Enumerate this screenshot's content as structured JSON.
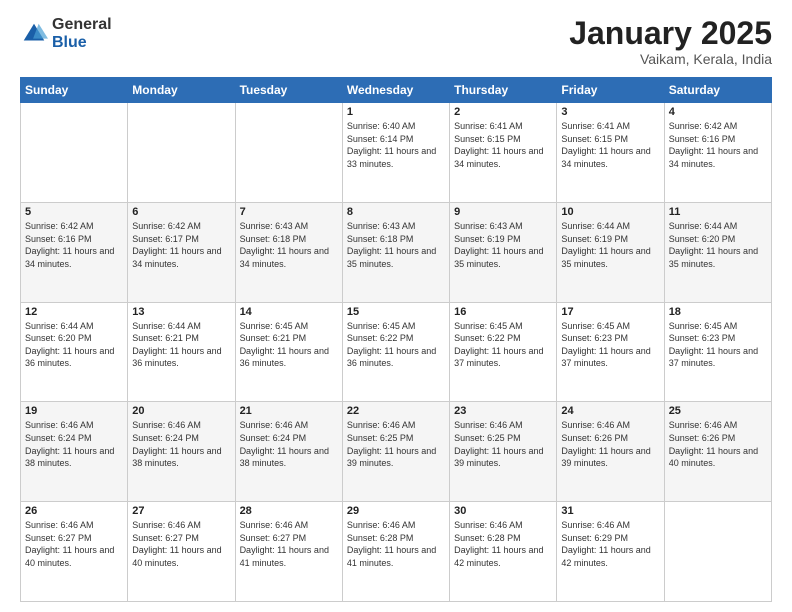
{
  "header": {
    "logo_general": "General",
    "logo_blue": "Blue",
    "title": "January 2025",
    "location": "Vaikam, Kerala, India"
  },
  "days_of_week": [
    "Sunday",
    "Monday",
    "Tuesday",
    "Wednesday",
    "Thursday",
    "Friday",
    "Saturday"
  ],
  "weeks": [
    [
      {
        "day": "",
        "sunrise": "",
        "sunset": "",
        "daylight": ""
      },
      {
        "day": "",
        "sunrise": "",
        "sunset": "",
        "daylight": ""
      },
      {
        "day": "",
        "sunrise": "",
        "sunset": "",
        "daylight": ""
      },
      {
        "day": "1",
        "sunrise": "Sunrise: 6:40 AM",
        "sunset": "Sunset: 6:14 PM",
        "daylight": "Daylight: 11 hours and 33 minutes."
      },
      {
        "day": "2",
        "sunrise": "Sunrise: 6:41 AM",
        "sunset": "Sunset: 6:15 PM",
        "daylight": "Daylight: 11 hours and 34 minutes."
      },
      {
        "day": "3",
        "sunrise": "Sunrise: 6:41 AM",
        "sunset": "Sunset: 6:15 PM",
        "daylight": "Daylight: 11 hours and 34 minutes."
      },
      {
        "day": "4",
        "sunrise": "Sunrise: 6:42 AM",
        "sunset": "Sunset: 6:16 PM",
        "daylight": "Daylight: 11 hours and 34 minutes."
      }
    ],
    [
      {
        "day": "5",
        "sunrise": "Sunrise: 6:42 AM",
        "sunset": "Sunset: 6:16 PM",
        "daylight": "Daylight: 11 hours and 34 minutes."
      },
      {
        "day": "6",
        "sunrise": "Sunrise: 6:42 AM",
        "sunset": "Sunset: 6:17 PM",
        "daylight": "Daylight: 11 hours and 34 minutes."
      },
      {
        "day": "7",
        "sunrise": "Sunrise: 6:43 AM",
        "sunset": "Sunset: 6:18 PM",
        "daylight": "Daylight: 11 hours and 34 minutes."
      },
      {
        "day": "8",
        "sunrise": "Sunrise: 6:43 AM",
        "sunset": "Sunset: 6:18 PM",
        "daylight": "Daylight: 11 hours and 35 minutes."
      },
      {
        "day": "9",
        "sunrise": "Sunrise: 6:43 AM",
        "sunset": "Sunset: 6:19 PM",
        "daylight": "Daylight: 11 hours and 35 minutes."
      },
      {
        "day": "10",
        "sunrise": "Sunrise: 6:44 AM",
        "sunset": "Sunset: 6:19 PM",
        "daylight": "Daylight: 11 hours and 35 minutes."
      },
      {
        "day": "11",
        "sunrise": "Sunrise: 6:44 AM",
        "sunset": "Sunset: 6:20 PM",
        "daylight": "Daylight: 11 hours and 35 minutes."
      }
    ],
    [
      {
        "day": "12",
        "sunrise": "Sunrise: 6:44 AM",
        "sunset": "Sunset: 6:20 PM",
        "daylight": "Daylight: 11 hours and 36 minutes."
      },
      {
        "day": "13",
        "sunrise": "Sunrise: 6:44 AM",
        "sunset": "Sunset: 6:21 PM",
        "daylight": "Daylight: 11 hours and 36 minutes."
      },
      {
        "day": "14",
        "sunrise": "Sunrise: 6:45 AM",
        "sunset": "Sunset: 6:21 PM",
        "daylight": "Daylight: 11 hours and 36 minutes."
      },
      {
        "day": "15",
        "sunrise": "Sunrise: 6:45 AM",
        "sunset": "Sunset: 6:22 PM",
        "daylight": "Daylight: 11 hours and 36 minutes."
      },
      {
        "day": "16",
        "sunrise": "Sunrise: 6:45 AM",
        "sunset": "Sunset: 6:22 PM",
        "daylight": "Daylight: 11 hours and 37 minutes."
      },
      {
        "day": "17",
        "sunrise": "Sunrise: 6:45 AM",
        "sunset": "Sunset: 6:23 PM",
        "daylight": "Daylight: 11 hours and 37 minutes."
      },
      {
        "day": "18",
        "sunrise": "Sunrise: 6:45 AM",
        "sunset": "Sunset: 6:23 PM",
        "daylight": "Daylight: 11 hours and 37 minutes."
      }
    ],
    [
      {
        "day": "19",
        "sunrise": "Sunrise: 6:46 AM",
        "sunset": "Sunset: 6:24 PM",
        "daylight": "Daylight: 11 hours and 38 minutes."
      },
      {
        "day": "20",
        "sunrise": "Sunrise: 6:46 AM",
        "sunset": "Sunset: 6:24 PM",
        "daylight": "Daylight: 11 hours and 38 minutes."
      },
      {
        "day": "21",
        "sunrise": "Sunrise: 6:46 AM",
        "sunset": "Sunset: 6:24 PM",
        "daylight": "Daylight: 11 hours and 38 minutes."
      },
      {
        "day": "22",
        "sunrise": "Sunrise: 6:46 AM",
        "sunset": "Sunset: 6:25 PM",
        "daylight": "Daylight: 11 hours and 39 minutes."
      },
      {
        "day": "23",
        "sunrise": "Sunrise: 6:46 AM",
        "sunset": "Sunset: 6:25 PM",
        "daylight": "Daylight: 11 hours and 39 minutes."
      },
      {
        "day": "24",
        "sunrise": "Sunrise: 6:46 AM",
        "sunset": "Sunset: 6:26 PM",
        "daylight": "Daylight: 11 hours and 39 minutes."
      },
      {
        "day": "25",
        "sunrise": "Sunrise: 6:46 AM",
        "sunset": "Sunset: 6:26 PM",
        "daylight": "Daylight: 11 hours and 40 minutes."
      }
    ],
    [
      {
        "day": "26",
        "sunrise": "Sunrise: 6:46 AM",
        "sunset": "Sunset: 6:27 PM",
        "daylight": "Daylight: 11 hours and 40 minutes."
      },
      {
        "day": "27",
        "sunrise": "Sunrise: 6:46 AM",
        "sunset": "Sunset: 6:27 PM",
        "daylight": "Daylight: 11 hours and 40 minutes."
      },
      {
        "day": "28",
        "sunrise": "Sunrise: 6:46 AM",
        "sunset": "Sunset: 6:27 PM",
        "daylight": "Daylight: 11 hours and 41 minutes."
      },
      {
        "day": "29",
        "sunrise": "Sunrise: 6:46 AM",
        "sunset": "Sunset: 6:28 PM",
        "daylight": "Daylight: 11 hours and 41 minutes."
      },
      {
        "day": "30",
        "sunrise": "Sunrise: 6:46 AM",
        "sunset": "Sunset: 6:28 PM",
        "daylight": "Daylight: 11 hours and 42 minutes."
      },
      {
        "day": "31",
        "sunrise": "Sunrise: 6:46 AM",
        "sunset": "Sunset: 6:29 PM",
        "daylight": "Daylight: 11 hours and 42 minutes."
      },
      {
        "day": "",
        "sunrise": "",
        "sunset": "",
        "daylight": ""
      }
    ]
  ]
}
